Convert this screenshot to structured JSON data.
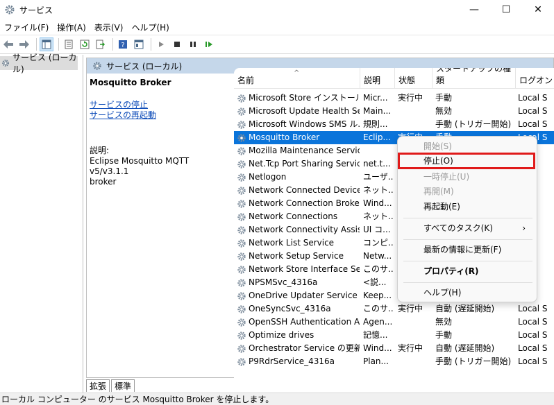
{
  "window": {
    "title": "サービス",
    "minimize_glyph": "—",
    "maximize_glyph": "☐",
    "close_glyph": "✕"
  },
  "menu": [
    "ファイル(F)",
    "操作(A)",
    "表示(V)",
    "ヘルプ(H)"
  ],
  "toolbar_icons": [
    "back-icon",
    "forward-icon",
    "console-tree-icon",
    "properties-icon",
    "refresh-icon",
    "export-icon",
    "help-icon",
    "view-icon",
    "start-icon",
    "stop-icon",
    "pause-icon",
    "resume-icon"
  ],
  "tree": {
    "item": "サービス (ローカル)"
  },
  "panel": {
    "header": "サービス (ローカル)"
  },
  "description": {
    "service_name": "Mosquitto Broker",
    "link_stop": "サービスの停止",
    "link_restart": "サービスの再起動",
    "label": "説明:",
    "text_line1": "Eclipse Mosquitto MQTT v5/v3.1.1",
    "text_line2": "broker"
  },
  "columns": [
    "名前",
    "説明",
    "状態",
    "スタートアップの種類",
    "ログオン"
  ],
  "rows": [
    {
      "name": "Microsoft Store インストール ...",
      "desc": "Micr...",
      "status": "実行中",
      "startup": "手動",
      "logon": "Local S"
    },
    {
      "name": "Microsoft Update Health Se...",
      "desc": "Main...",
      "status": "",
      "startup": "無効",
      "logon": "Local S"
    },
    {
      "name": "Microsoft Windows SMS ル...",
      "desc": "規則...",
      "status": "",
      "startup": "手動 (トリガー開始)",
      "logon": "Local S"
    },
    {
      "name": "Mosquitto Broker",
      "desc": "Eclip...",
      "status": "実行中",
      "startup": "手動",
      "logon": "Local S"
    },
    {
      "name": "Mozilla Maintenance Service",
      "desc": "",
      "status": "",
      "startup": "",
      "logon": ""
    },
    {
      "name": "Net.Tcp Port Sharing Service",
      "desc": "net.t...",
      "status": "",
      "startup": "",
      "logon": ""
    },
    {
      "name": "Netlogon",
      "desc": "ユーザ...",
      "status": "",
      "startup": "",
      "logon": ""
    },
    {
      "name": "Network Connected Device...",
      "desc": "ネット...",
      "status": "",
      "startup": "",
      "logon": ""
    },
    {
      "name": "Network Connection Broker",
      "desc": "Wind...",
      "status": "",
      "startup": "",
      "logon": ""
    },
    {
      "name": "Network Connections",
      "desc": "ネット...",
      "status": "",
      "startup": "",
      "logon": ""
    },
    {
      "name": "Network Connectivity Assist...",
      "desc": "UI コ...",
      "status": "",
      "startup": "",
      "logon": ""
    },
    {
      "name": "Network List Service",
      "desc": "コンピ...",
      "status": "",
      "startup": "",
      "logon": ""
    },
    {
      "name": "Network Setup Service",
      "desc": "Netw...",
      "status": "",
      "startup": "",
      "logon": ""
    },
    {
      "name": "Network Store Interface Ser...",
      "desc": "このサ...",
      "status": "",
      "startup": "",
      "logon": ""
    },
    {
      "name": "NPSMSvc_4316a",
      "desc": "<説...",
      "status": "",
      "startup": "",
      "logon": ""
    },
    {
      "name": "OneDrive Updater Service",
      "desc": "Keep...",
      "status": "",
      "startup": "",
      "logon": ""
    },
    {
      "name": "OneSyncSvc_4316a",
      "desc": "このサ...",
      "status": "実行中",
      "startup": "自動 (遅延開始)",
      "logon": "Local S"
    },
    {
      "name": "OpenSSH Authentication A...",
      "desc": "Agen...",
      "status": "",
      "startup": "無効",
      "logon": "Local S"
    },
    {
      "name": "Optimize drives",
      "desc": "記憶...",
      "status": "",
      "startup": "手動",
      "logon": "Local S"
    },
    {
      "name": "Orchestrator Service の更新",
      "desc": "Wind...",
      "status": "実行中",
      "startup": "自動 (遅延開始)",
      "logon": "Local S"
    },
    {
      "name": "P9RdrService_4316a",
      "desc": "Plan...",
      "status": "",
      "startup": "手動 (トリガー開始)",
      "logon": "Local S"
    }
  ],
  "selected_row": 3,
  "context_menu": {
    "start": "開始(S)",
    "stop": "停止(O)",
    "pause": "一時停止(U)",
    "resume": "再開(M)",
    "restart": "再起動(E)",
    "all_tasks": "すべてのタスク(K)",
    "all_tasks_arrow": "›",
    "refresh": "最新の情報に更新(F)",
    "properties": "プロパティ(R)",
    "help": "ヘルプ(H)"
  },
  "tabs": [
    "拡張",
    "標準"
  ],
  "statusbar": "ローカル コンピューター のサービス Mosquitto Broker を停止します。",
  "colors": {
    "selection": "#0a74da",
    "header_bar": "#c5d7ea",
    "highlight_box": "#e01a1a",
    "link": "#0b4ab8"
  }
}
